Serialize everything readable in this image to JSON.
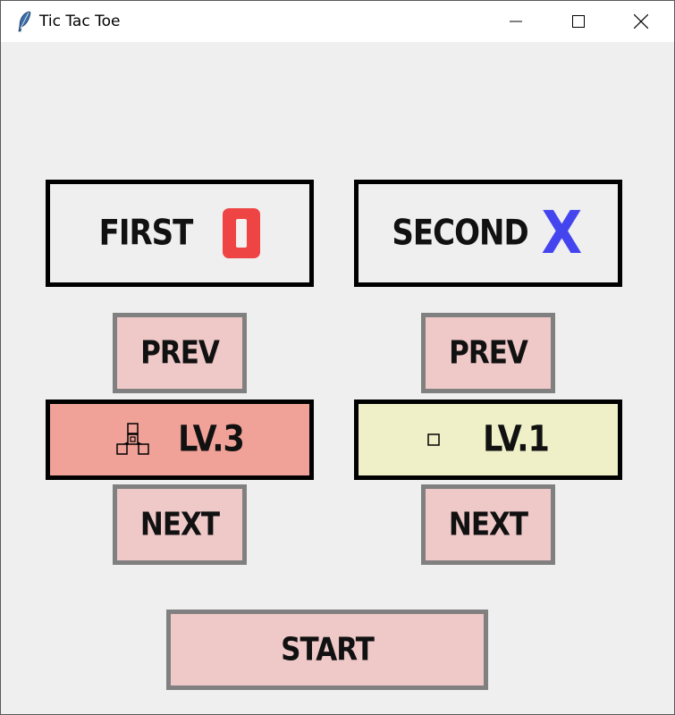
{
  "window": {
    "title": "Tic Tac Toe",
    "app_icon": "feather-icon",
    "controls": [
      "minimize-icon",
      "maximize-icon",
      "close-icon"
    ]
  },
  "players": {
    "first": {
      "label": "FIRST",
      "mark": "O",
      "mark_color": "#ef4444"
    },
    "second": {
      "label": "SECOND",
      "mark": "X",
      "mark_color": "#4545f0"
    }
  },
  "left_column": {
    "prev_label": "PREV",
    "level_label": "LV.3",
    "level_icon": "level-3-tree-icon",
    "level_color": "#f0a298",
    "next_label": "NEXT"
  },
  "right_column": {
    "prev_label": "PREV",
    "level_label": "LV.1",
    "level_icon": "level-1-square-icon",
    "level_color": "#efefc8",
    "next_label": "NEXT"
  },
  "start_label": "START",
  "colors": {
    "button_fill": "#efc8c8",
    "button_border": "#808080",
    "background": "#efefef"
  }
}
